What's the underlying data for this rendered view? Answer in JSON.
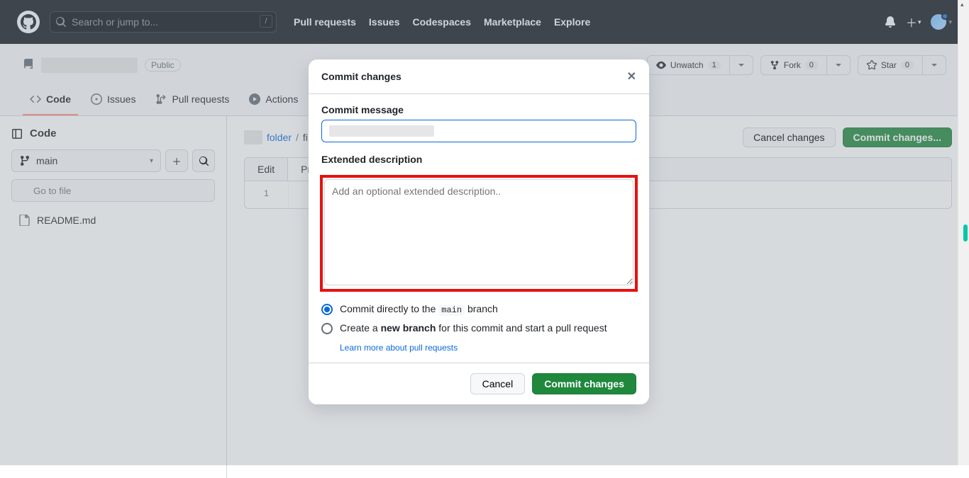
{
  "header": {
    "search_placeholder": "Search or jump to...",
    "slash_key": "/",
    "nav": [
      "Pull requests",
      "Issues",
      "Codespaces",
      "Marketplace",
      "Explore"
    ]
  },
  "repo": {
    "visibility": "Public",
    "unwatch_label": "Unwatch",
    "unwatch_count": "1",
    "fork_label": "Fork",
    "fork_count": "0",
    "star_label": "Star",
    "star_count": "0",
    "tabs": {
      "code": "Code",
      "issues": "Issues",
      "pulls": "Pull requests",
      "actions": "Actions"
    }
  },
  "sidebar": {
    "title": "Code",
    "branch": "main",
    "filter_placeholder": "Go to file",
    "files": [
      "README.md"
    ]
  },
  "breadcrumb": {
    "folder": "folder",
    "file_prefix": "fi"
  },
  "content_actions": {
    "cancel": "Cancel changes",
    "commit": "Commit changes..."
  },
  "editor": {
    "tab_edit": "Edit",
    "tab_preview": "Prev",
    "line_no": "1"
  },
  "dialog": {
    "title": "Commit changes",
    "commit_message_label": "Commit message",
    "extended_label": "Extended description",
    "extended_placeholder": "Add an optional extended description..",
    "opt_direct_pre": "Commit directly to the ",
    "opt_direct_branch": "main",
    "opt_direct_post": " branch",
    "opt_new_pre": "Create a ",
    "opt_new_strong": "new branch",
    "opt_new_post": " for this commit and start a pull request",
    "learn_link": "Learn more about pull requests",
    "cancel": "Cancel",
    "commit": "Commit changes"
  }
}
